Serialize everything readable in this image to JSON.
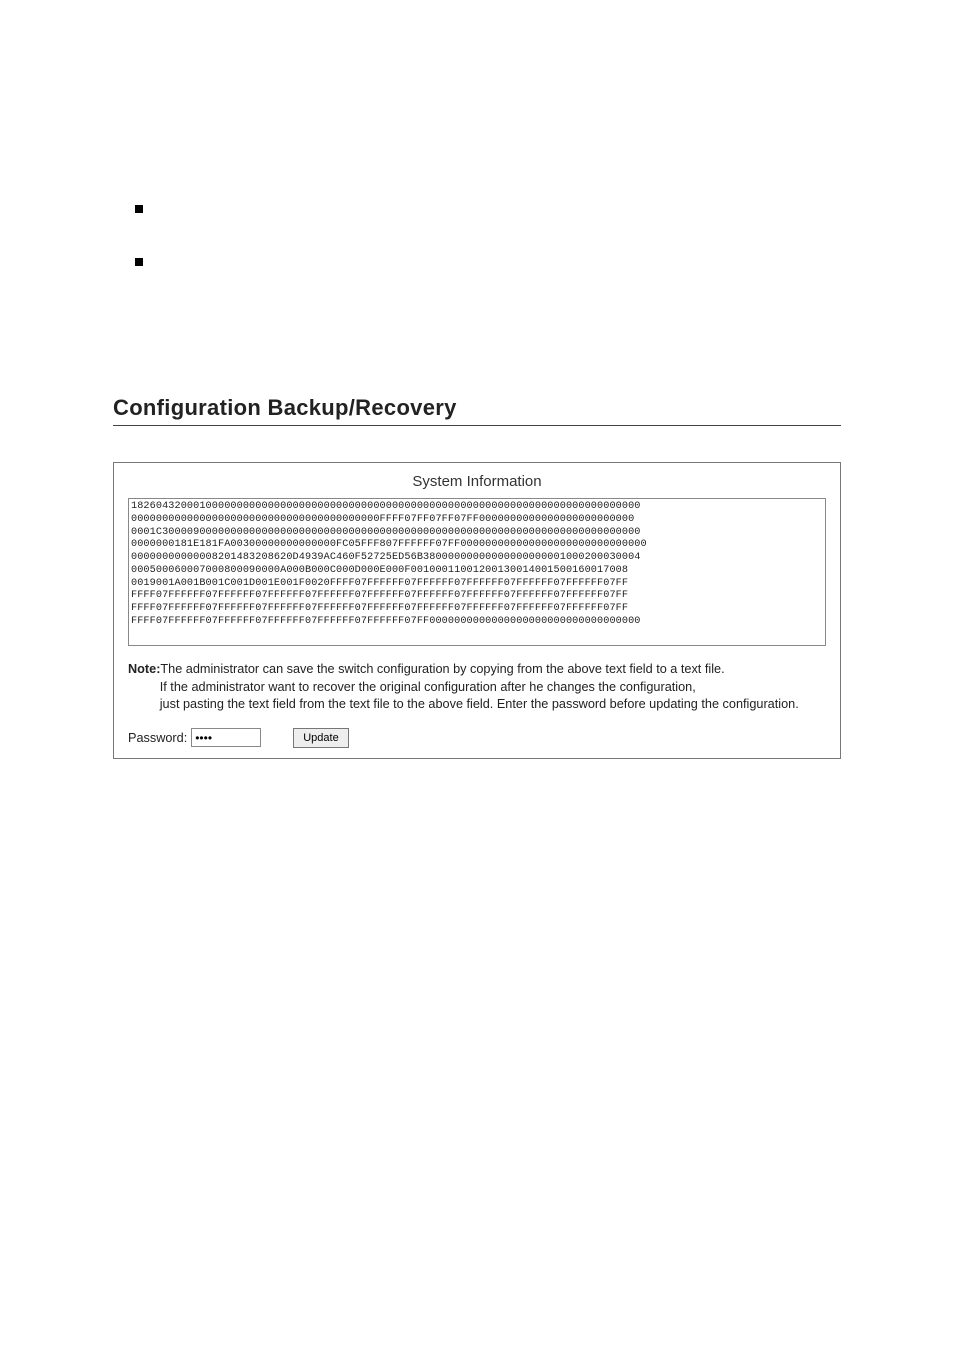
{
  "bullets": [
    "",
    ""
  ],
  "panel": {
    "title": "Configuration Backup/Recovery",
    "system_info_header": "System Information",
    "dump": "1826043200010000000000000000000000000000000000000000000000000000000000000000000000\n0000000000000000000000000000000000000000FFFF07FF07FF07FF0000000000000000000000000\n0001C30000900000000000000000000000000000000000000000000000000000000000000000000000\n0000000181E181FA00300000000000000FC05FFF807FFFFFF07FF000000000000000000000000000000\n00000000000008201483208620D4939AC460F52725ED56B38000000000000000000001000200030004\n000500060007000800090000A000B000C000D000E000F00100011001200130014001500160017008\n0019001A001B001C001D001E001F0020FFFF07FFFFFF07FFFFFF07FFFFFF07FFFFFF07FFFFFF07FF\nFFFF07FFFFFF07FFFFFF07FFFFFF07FFFFFF07FFFFFF07FFFFFF07FFFFFF07FFFFFF07FFFFFF07FF\nFFFF07FFFFFF07FFFFFF07FFFFFF07FFFFFF07FFFFFF07FFFFFF07FFFFFF07FFFFFF07FFFFFF07FF\nFFFF07FFFFFF07FFFFFF07FFFFFF07FFFFFF07FFFFFF07FF0000000000000000000000000000000000",
    "note_label": "Note:",
    "note_line1": "The administrator can save the switch configuration by copying from the above text field to a text file.",
    "note_line2": "If the administrator want to recover the original configuration after he changes the configuration,",
    "note_line3": "just pasting the text field from the text file to the above field. Enter the password before updating the configuration.",
    "password_label": "Password:",
    "password_value": "••••",
    "update_label": "Update"
  }
}
